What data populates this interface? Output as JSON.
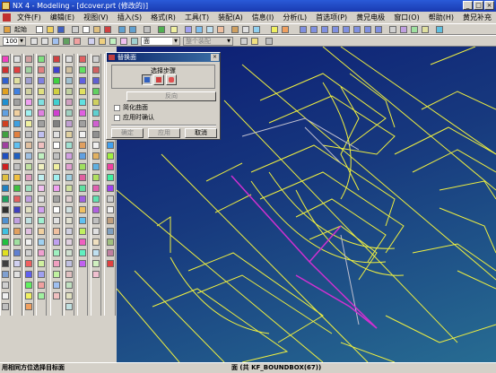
{
  "window": {
    "title": "NX 4 - Modeling - [dcover.prt (修改的)]"
  },
  "menu": {
    "items": [
      "文件(F)",
      "编辑(E)",
      "视图(V)",
      "插入(S)",
      "格式(R)",
      "工具(T)",
      "装配(A)",
      "信息(I)",
      "分析(L)",
      "首选项(P)",
      "黄兄电极",
      "窗口(O)",
      "帮助(H)",
      "黄兄补充"
    ]
  },
  "toolbar": {
    "start_label": "起始",
    "filter_value": "面",
    "display_value": "整个装配",
    "zoom_value": "100"
  },
  "dialog": {
    "title": "替换面",
    "selection_steps_label": "选择步骤",
    "filter_button": "反向",
    "simplify_label": "简化曲面",
    "confirm_on_apply_label": "应用时确认",
    "ok_label": "确定",
    "apply_label": "应用",
    "cancel_label": "取消",
    "simplify_checked": false,
    "confirm_checked": false
  },
  "status": {
    "prompt": "用相同方位选择目标面",
    "selection": "面 (共 KF_BOUNDBOX(67))"
  },
  "colors": {
    "wireframe": "#f0f040",
    "highlight": "#d030d0",
    "viewport_top": "#0c1c74",
    "viewport_bottom": "#276c92"
  }
}
